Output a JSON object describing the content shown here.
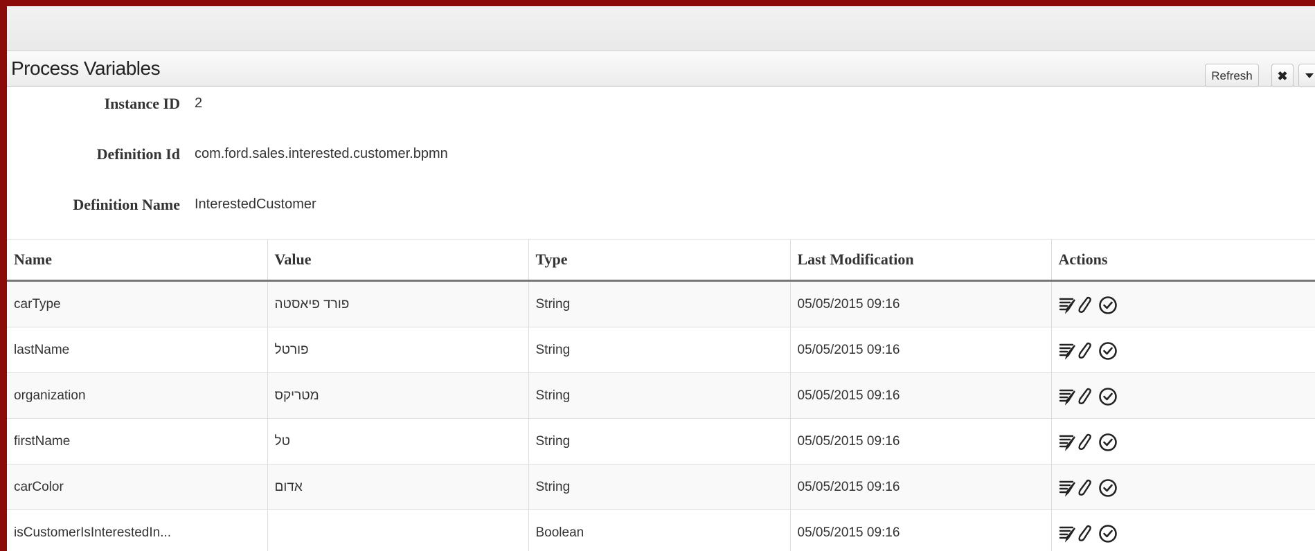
{
  "panel": {
    "title": "Process Variables",
    "refresh_label": "Refresh",
    "close_glyph": "✖"
  },
  "info": {
    "instance_id_label": "Instance ID",
    "instance_id": "2",
    "definition_id_label": "Definition Id",
    "definition_id": "com.ford.sales.interested.customer.bpmn",
    "definition_name_label": "Definition Name",
    "definition_name": "InterestedCustomer"
  },
  "table": {
    "columns": [
      "Name",
      "Value",
      "Type",
      "Last Modification",
      "Actions"
    ],
    "rows": [
      {
        "name": "carType",
        "value": "פורד פיאסטה",
        "type": "String",
        "modified": "05/05/2015 09:16"
      },
      {
        "name": "lastName",
        "value": "פורטל",
        "type": "String",
        "modified": "05/05/2015 09:16"
      },
      {
        "name": "organization",
        "value": "מטריקס",
        "type": "String",
        "modified": "05/05/2015 09:16"
      },
      {
        "name": "firstName",
        "value": "טל",
        "type": "String",
        "modified": "05/05/2015 09:16"
      },
      {
        "name": "carColor",
        "value": "אדום",
        "type": "String",
        "modified": "05/05/2015 09:16"
      },
      {
        "name": "isCustomerIsInterestedIn...",
        "value": "",
        "type": "Boolean",
        "modified": "05/05/2015 09:16"
      }
    ],
    "action_icons": [
      "history-icon",
      "edit-icon",
      "check-circle-icon"
    ]
  },
  "colors": {
    "outer_border": "#8b0a0a",
    "header_rule": "#777777",
    "text": "#333333"
  }
}
